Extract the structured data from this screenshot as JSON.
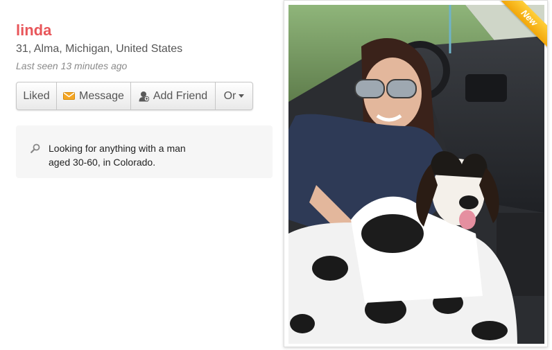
{
  "profile": {
    "name": "linda",
    "details": "31, Alma, Michigan, United States",
    "last_seen": "Last seen 13 minutes ago"
  },
  "actions": {
    "liked_label": "Liked",
    "message_label": "Message",
    "add_friend_label": "Add Friend",
    "or_label": "Or",
    "message_icon": "envelope-icon",
    "add_friend_icon": "person-add-icon",
    "or_icon": "caret-down-icon"
  },
  "looking_for": {
    "icon": "search-icon",
    "text": "Looking for anything with a man aged 30-60, in Colorado."
  },
  "photo": {
    "badge": "New",
    "subject": "woman-with-dog-in-car"
  },
  "colors": {
    "name": "#e8565a",
    "badge": "#f2a60a",
    "envelope": "#f5a623"
  }
}
